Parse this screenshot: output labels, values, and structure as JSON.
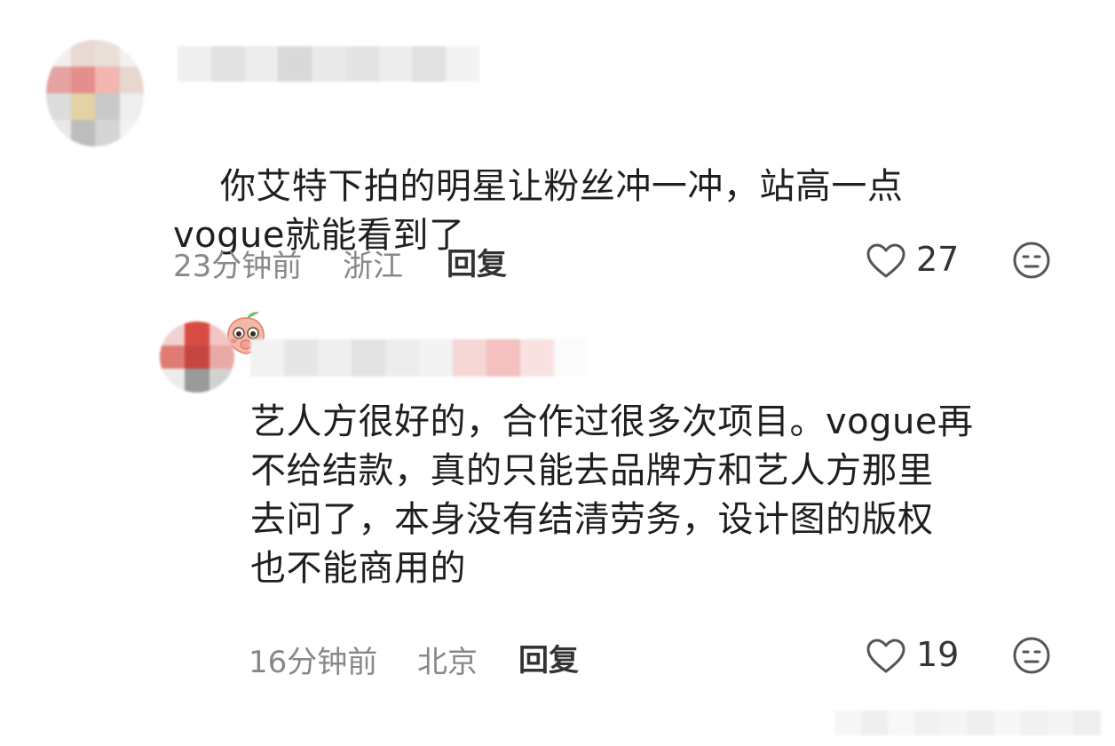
{
  "comments": [
    {
      "text": "你艾特下拍的明星让粉丝冲一冲，站高一点\nvogue就能看到了",
      "emoji": "peach-shy-emoji",
      "time": "23分钟前",
      "location": "浙江",
      "reply_label": "回复",
      "likes": "27"
    },
    {
      "text": "艺人方很好的，合作过很多次项目。vogue再\n不给结款，真的只能去品牌方和艺人方那里\n去问了，本身没有结清劳务，设计图的版权\n也不能商用的",
      "time": "16分钟前",
      "location": "北京",
      "reply_label": "回复",
      "likes": "19"
    }
  ],
  "icons": {
    "like": "heart-outline-icon",
    "dislike": "neutral-face-icon"
  },
  "colors": {
    "text": "#1f1f1f",
    "meta": "#888888",
    "icon": "#555555"
  }
}
